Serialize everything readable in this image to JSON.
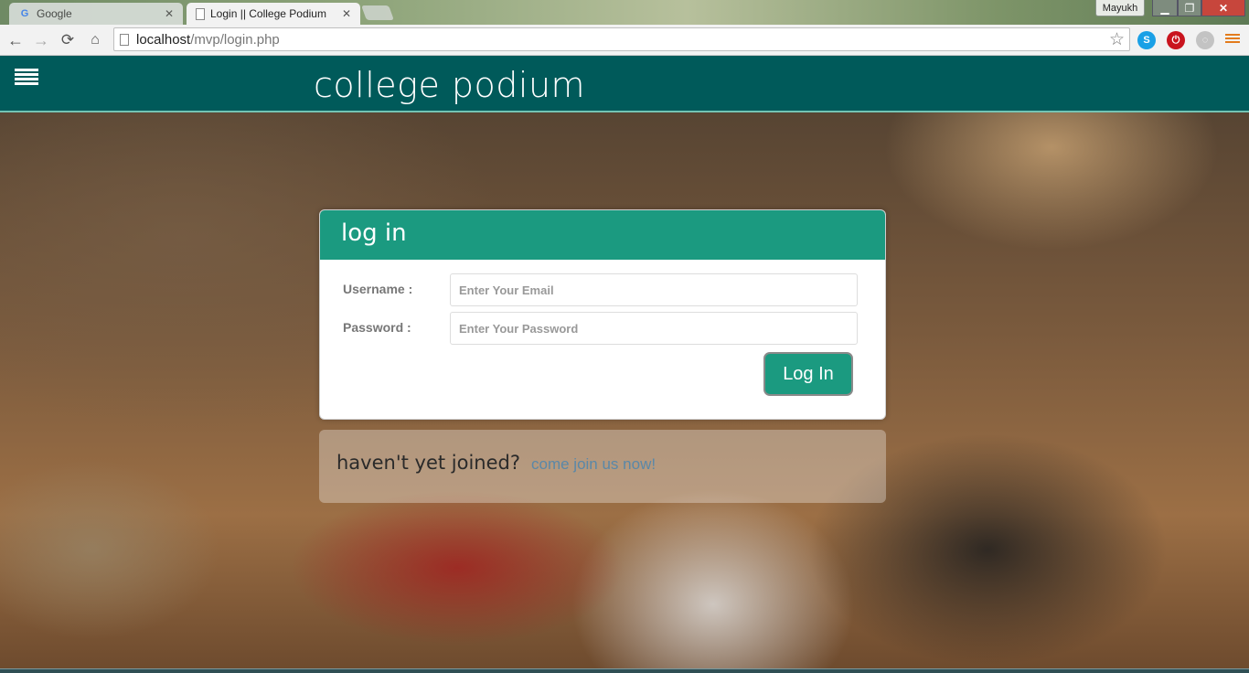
{
  "browser": {
    "tabs": [
      {
        "title": "Google",
        "favicon": "google-g-icon",
        "active": false
      },
      {
        "title": "Login || College Podium",
        "favicon": "page-icon",
        "active": true
      }
    ],
    "profile_name": "Mayukh",
    "url_host": "localhost",
    "url_path": "/mvp/login.php",
    "extensions": [
      "skype-icon",
      "adblock-icon",
      "extension-icon"
    ],
    "menu_icon": "hamburger-menu-icon"
  },
  "site": {
    "brand": "college podium",
    "header_color": "#005a5a",
    "accent_color": "#1b9a80"
  },
  "login": {
    "heading": "log in",
    "username_label": "Username :",
    "username_placeholder": "Enter Your Email",
    "password_label": "Password :",
    "password_placeholder": "Enter Your Password",
    "submit_label": "Log In"
  },
  "join": {
    "question": "haven't yet joined?",
    "link_text": "come join us now!"
  }
}
